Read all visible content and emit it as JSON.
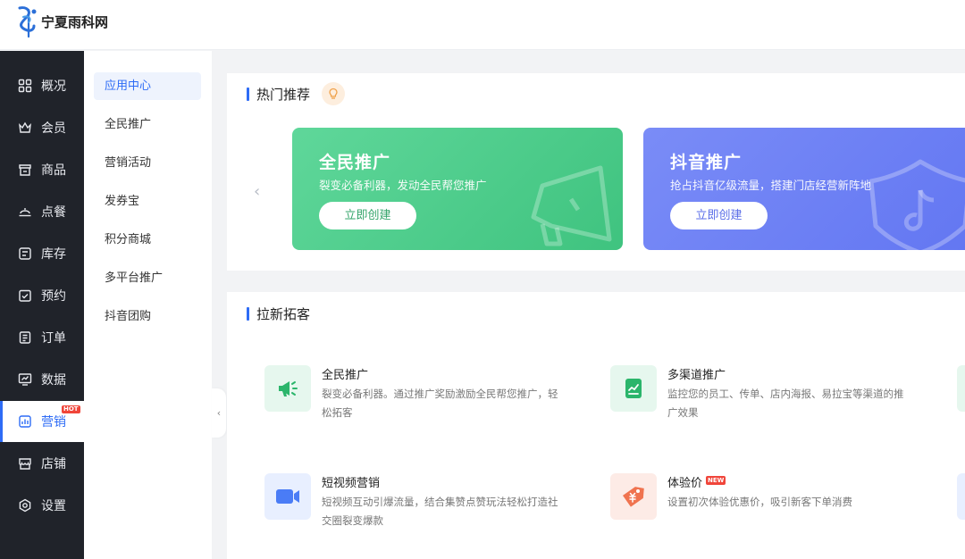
{
  "brand": {
    "name": "宁夏雨科网"
  },
  "primary_nav": {
    "items": [
      {
        "label": "概况",
        "icon": "grid-icon"
      },
      {
        "label": "会员",
        "icon": "crown-icon"
      },
      {
        "label": "商品",
        "icon": "shop-icon"
      },
      {
        "label": "点餐",
        "icon": "dish-icon"
      },
      {
        "label": "库存",
        "icon": "inventory-icon"
      },
      {
        "label": "预约",
        "icon": "calendar-check-icon"
      },
      {
        "label": "订单",
        "icon": "order-icon"
      },
      {
        "label": "数据",
        "icon": "monitor-chart-icon"
      },
      {
        "label": "营销",
        "icon": "marketing-chart-icon",
        "badge": "HOT",
        "active": true
      },
      {
        "label": "店铺",
        "icon": "store-icon"
      },
      {
        "label": "设置",
        "icon": "settings-icon"
      }
    ]
  },
  "sub_nav": {
    "items": [
      {
        "label": "应用中心",
        "active": true
      },
      {
        "label": "全民推广"
      },
      {
        "label": "营销活动"
      },
      {
        "label": "发券宝"
      },
      {
        "label": "积分商城"
      },
      {
        "label": "多平台推广"
      },
      {
        "label": "抖音团购"
      }
    ]
  },
  "hot_section": {
    "title": "热门推荐",
    "cards": [
      {
        "title": "全民推广",
        "subtitle": "裂变必备利器，发动全民帮您推广",
        "button": "立即创建",
        "color": "#4ccb88"
      },
      {
        "title": "抖音推广",
        "subtitle": "抢占抖音亿级流量，搭建门店经营新阵地",
        "button": "立即创建",
        "color": "#6b7ff4"
      }
    ]
  },
  "new_section": {
    "title": "拉新拓客",
    "features": [
      {
        "name": "全民推广",
        "desc": "裂变必备利器。通过推广奖励激励全民帮您推广，轻松拓客",
        "icon": "megaphone-icon"
      },
      {
        "name": "多渠道推广",
        "desc": "监控您的员工、传单、店内海报、易拉宝等渠道的推广效果",
        "icon": "document-chart-icon"
      },
      {
        "name": "短视频营销",
        "desc": "短视频互动引爆流量，结合集赞点赞玩法轻松打造社交圈裂变爆款",
        "icon": "video-camera-icon"
      },
      {
        "name": "体验价",
        "desc": "设置初次体验优惠价，吸引新客下单消费",
        "icon": "price-tag-icon",
        "badge": "NEW"
      }
    ]
  },
  "colors": {
    "accent": "#2e6cf6",
    "sidebar_bg": "#20232a",
    "hot_badge": "#f0453a"
  }
}
